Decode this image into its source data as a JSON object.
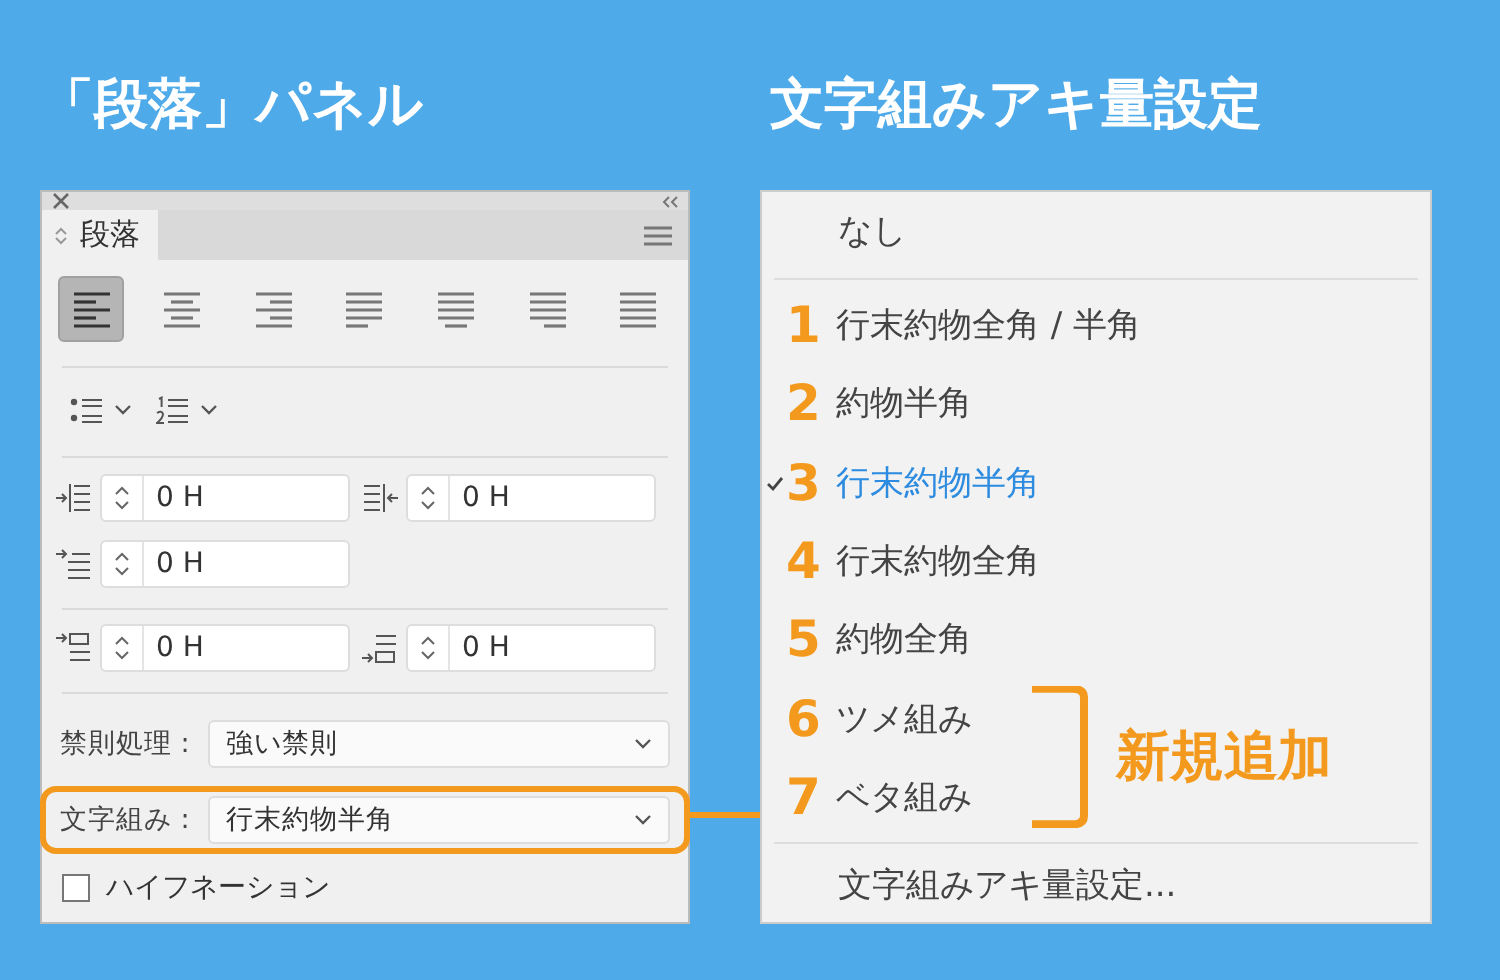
{
  "panel_heading": "「段落」パネル",
  "menu_heading": "文字組みアキ量設定",
  "panel": {
    "tab": "段落",
    "alignment_buttons": [
      {
        "kind": "left",
        "selected": true
      },
      {
        "kind": "center",
        "selected": false
      },
      {
        "kind": "right",
        "selected": false
      },
      {
        "kind": "justify-left",
        "selected": false
      },
      {
        "kind": "justify-center",
        "selected": false
      },
      {
        "kind": "justify-right",
        "selected": false
      },
      {
        "kind": "justify-all",
        "selected": false
      }
    ],
    "indent_rows": [
      [
        {
          "kind": "left-indent",
          "value": "0 H"
        },
        {
          "kind": "right-indent",
          "value": "0 H"
        }
      ],
      [
        {
          "kind": "first-line",
          "value": "0 H"
        }
      ]
    ],
    "spacing_row": [
      {
        "kind": "space-before",
        "value": "0 H"
      },
      {
        "kind": "space-after",
        "value": "0 H"
      }
    ],
    "selects": [
      {
        "label": "禁則処理 :",
        "value": "強い禁則",
        "highlighted": false
      },
      {
        "label": "文字組み :",
        "value": "行末約物半角",
        "highlighted": true
      }
    ],
    "hyphenation": {
      "label": "ハイフネーション",
      "checked": false
    }
  },
  "menu": {
    "none_item": "なし",
    "items": [
      {
        "number": "1",
        "label": "行末約物全角 / 半角",
        "selected": false,
        "new": false
      },
      {
        "number": "2",
        "label": "約物半角",
        "selected": false,
        "new": false
      },
      {
        "number": "3",
        "label": "行末約物半角",
        "selected": true,
        "new": false
      },
      {
        "number": "4",
        "label": "行末約物全角",
        "selected": false,
        "new": false
      },
      {
        "number": "5",
        "label": "約物全角",
        "selected": false,
        "new": false
      },
      {
        "number": "6",
        "label": "ツメ組み",
        "selected": false,
        "new": true
      },
      {
        "number": "7",
        "label": "ベタ組み",
        "selected": false,
        "new": true
      }
    ],
    "new_label": "新規追加",
    "settings_item": "文字組みアキ量設定..."
  }
}
